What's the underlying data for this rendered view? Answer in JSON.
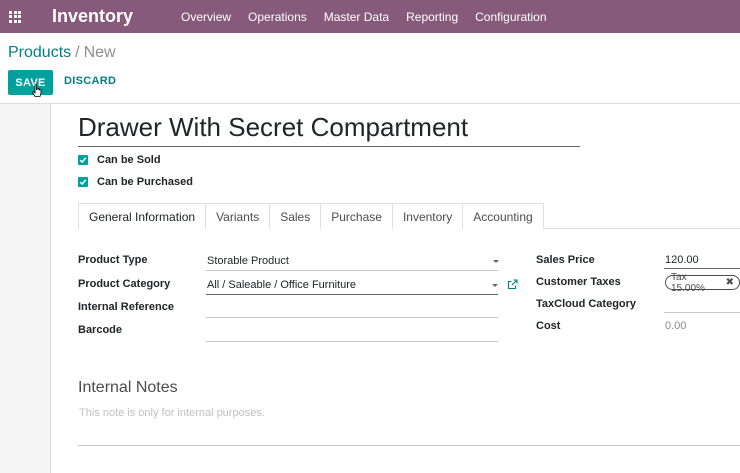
{
  "navbar": {
    "brand": "Inventory",
    "menu": [
      "Overview",
      "Operations",
      "Master Data",
      "Reporting",
      "Configuration"
    ]
  },
  "breadcrumb": {
    "parent": "Products",
    "separator": "/",
    "current": "New"
  },
  "actions": {
    "save": "SAVE",
    "discard": "DISCARD"
  },
  "product": {
    "name": "Drawer With Secret Compartment",
    "can_be_sold": {
      "label": "Can be Sold",
      "checked": true
    },
    "can_be_purchased": {
      "label": "Can be Purchased",
      "checked": true
    }
  },
  "tabs": [
    "General Information",
    "Variants",
    "Sales",
    "Purchase",
    "Inventory",
    "Accounting"
  ],
  "active_tab": "General Information",
  "fields_left": {
    "product_type": {
      "label": "Product Type",
      "value": "Storable Product"
    },
    "product_category": {
      "label": "Product Category",
      "value": "All / Saleable / Office Furniture"
    },
    "internal_reference": {
      "label": "Internal Reference",
      "value": ""
    },
    "barcode": {
      "label": "Barcode",
      "value": ""
    }
  },
  "fields_right": {
    "sales_price": {
      "label": "Sales Price",
      "value": "120.00"
    },
    "customer_taxes": {
      "label": "Customer Taxes",
      "tag": "Tax 15.00%"
    },
    "taxcloud_category": {
      "label": "TaxCloud Category",
      "value": ""
    },
    "cost": {
      "label": "Cost",
      "value": "0.00"
    }
  },
  "notes": {
    "title": "Internal Notes",
    "placeholder": "This note is only for internal purposes."
  },
  "colors": {
    "navbar": "#875a7b",
    "primary": "#00a09d",
    "link": "#017e84"
  }
}
